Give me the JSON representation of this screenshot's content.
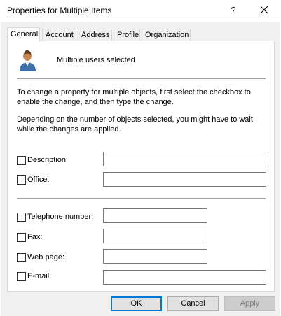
{
  "window": {
    "title": "Properties for Multiple Items",
    "help_glyph": "?"
  },
  "tabs": [
    {
      "label": "General",
      "active": true
    },
    {
      "label": "Account",
      "active": false
    },
    {
      "label": "Address",
      "active": false
    },
    {
      "label": "Profile",
      "active": false
    },
    {
      "label": "Organization",
      "active": false
    }
  ],
  "general": {
    "header_label": "Multiple users selected",
    "instructions": "To change a property for multiple objects, first select the checkbox to enable the change, and then type the change.",
    "wait_note": "Depending on the number of objects selected, you might have to wait while the changes are applied.",
    "fields": [
      {
        "label": "Description:",
        "checked": false,
        "value": ""
      },
      {
        "label": "Office:",
        "checked": false,
        "value": ""
      },
      {
        "label": "Telephone number:",
        "checked": false,
        "value": ""
      },
      {
        "label": "Fax:",
        "checked": false,
        "value": ""
      },
      {
        "label": "Web page:",
        "checked": false,
        "value": ""
      },
      {
        "label": "E-mail:",
        "checked": false,
        "value": ""
      }
    ]
  },
  "buttons": {
    "ok": "OK",
    "cancel": "Cancel",
    "apply": "Apply",
    "apply_enabled": false
  },
  "colors": {
    "accent": "#0078d7",
    "dialog_bg": "#f0f0f0",
    "panel_bg": "#ffffff"
  }
}
